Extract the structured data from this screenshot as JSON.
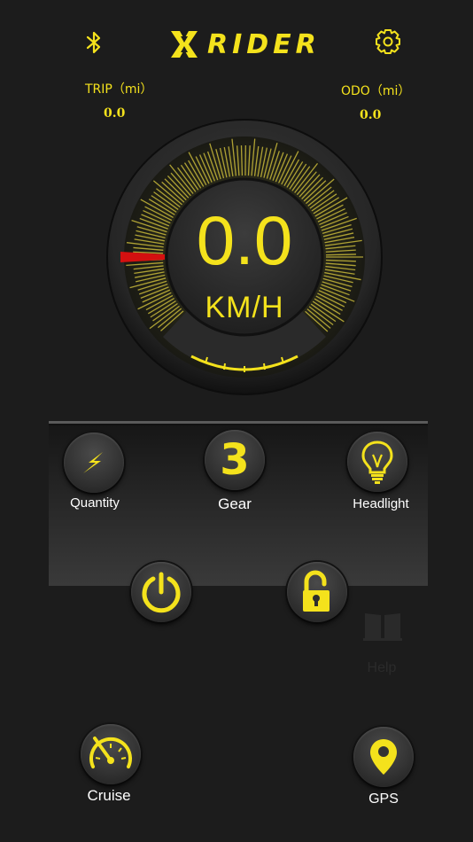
{
  "header": {
    "bluetooth_icon": "bluetooth-icon",
    "logo_text": "RIDER",
    "settings_icon": "gear-icon"
  },
  "stats": {
    "trip_label": "TRIP（mi）",
    "trip_value": "0.0",
    "odo_label": "ODO（mi）",
    "odo_value": "0.0"
  },
  "speedometer": {
    "speed": "0.0",
    "unit": "KM/H"
  },
  "controls": {
    "quantity_label": "Quantity",
    "gear_value": "3",
    "gear_label": "Gear",
    "headlight_label": "Headlight"
  },
  "help": {
    "label": "Help"
  },
  "bottom": {
    "cruise_label": "Cruise",
    "gps_label": "GPS"
  },
  "colors": {
    "accent": "#f4e21c",
    "background": "#1c1c1c",
    "needle": "#d41010"
  }
}
